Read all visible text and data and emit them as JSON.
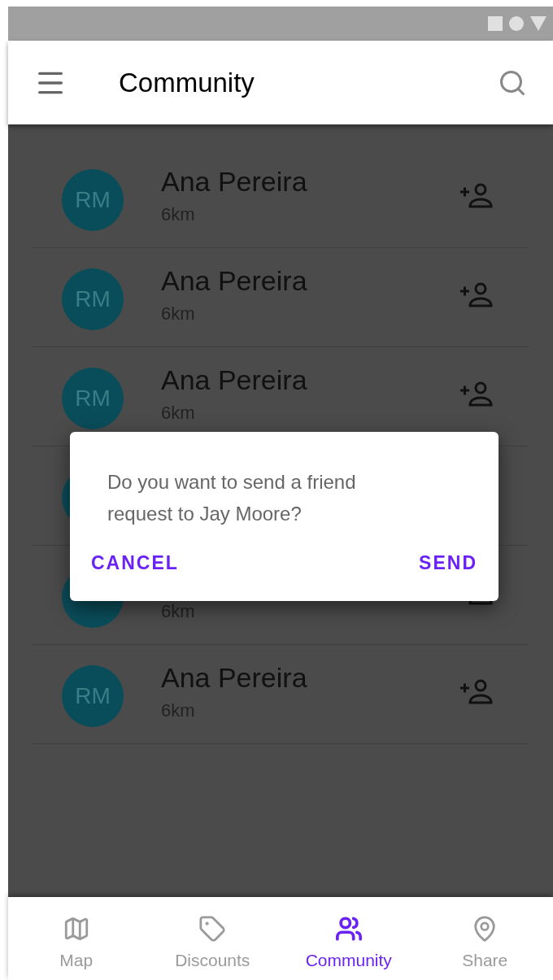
{
  "app_bar": {
    "title": "Community"
  },
  "people": [
    {
      "kind": "person",
      "initials": "RM",
      "name": "Ana Pereira",
      "distance": "6km"
    },
    {
      "kind": "person",
      "initials": "RM",
      "name": "Ana Pereira",
      "distance": "6km"
    },
    {
      "kind": "person",
      "initials": "RM",
      "name": "Ana Pereira",
      "distance": "6km"
    },
    {
      "kind": "covered"
    },
    {
      "kind": "covered",
      "distance": "6km"
    },
    {
      "kind": "person",
      "initials": "RM",
      "name": "Ana Pereira",
      "distance": "6km"
    }
  ],
  "dialog": {
    "message": "Do you want to send a friend request to Jay Moore?",
    "buttons": [
      "CANCEL",
      "SEND"
    ]
  },
  "bottom_nav": [
    {
      "label": "Map",
      "kind": "map",
      "selected": false
    },
    {
      "label": "Discounts",
      "kind": "tag",
      "selected": false
    },
    {
      "label": "Community",
      "kind": "people",
      "selected": true
    },
    {
      "label": "Share",
      "kind": "pin",
      "selected": false
    }
  ]
}
